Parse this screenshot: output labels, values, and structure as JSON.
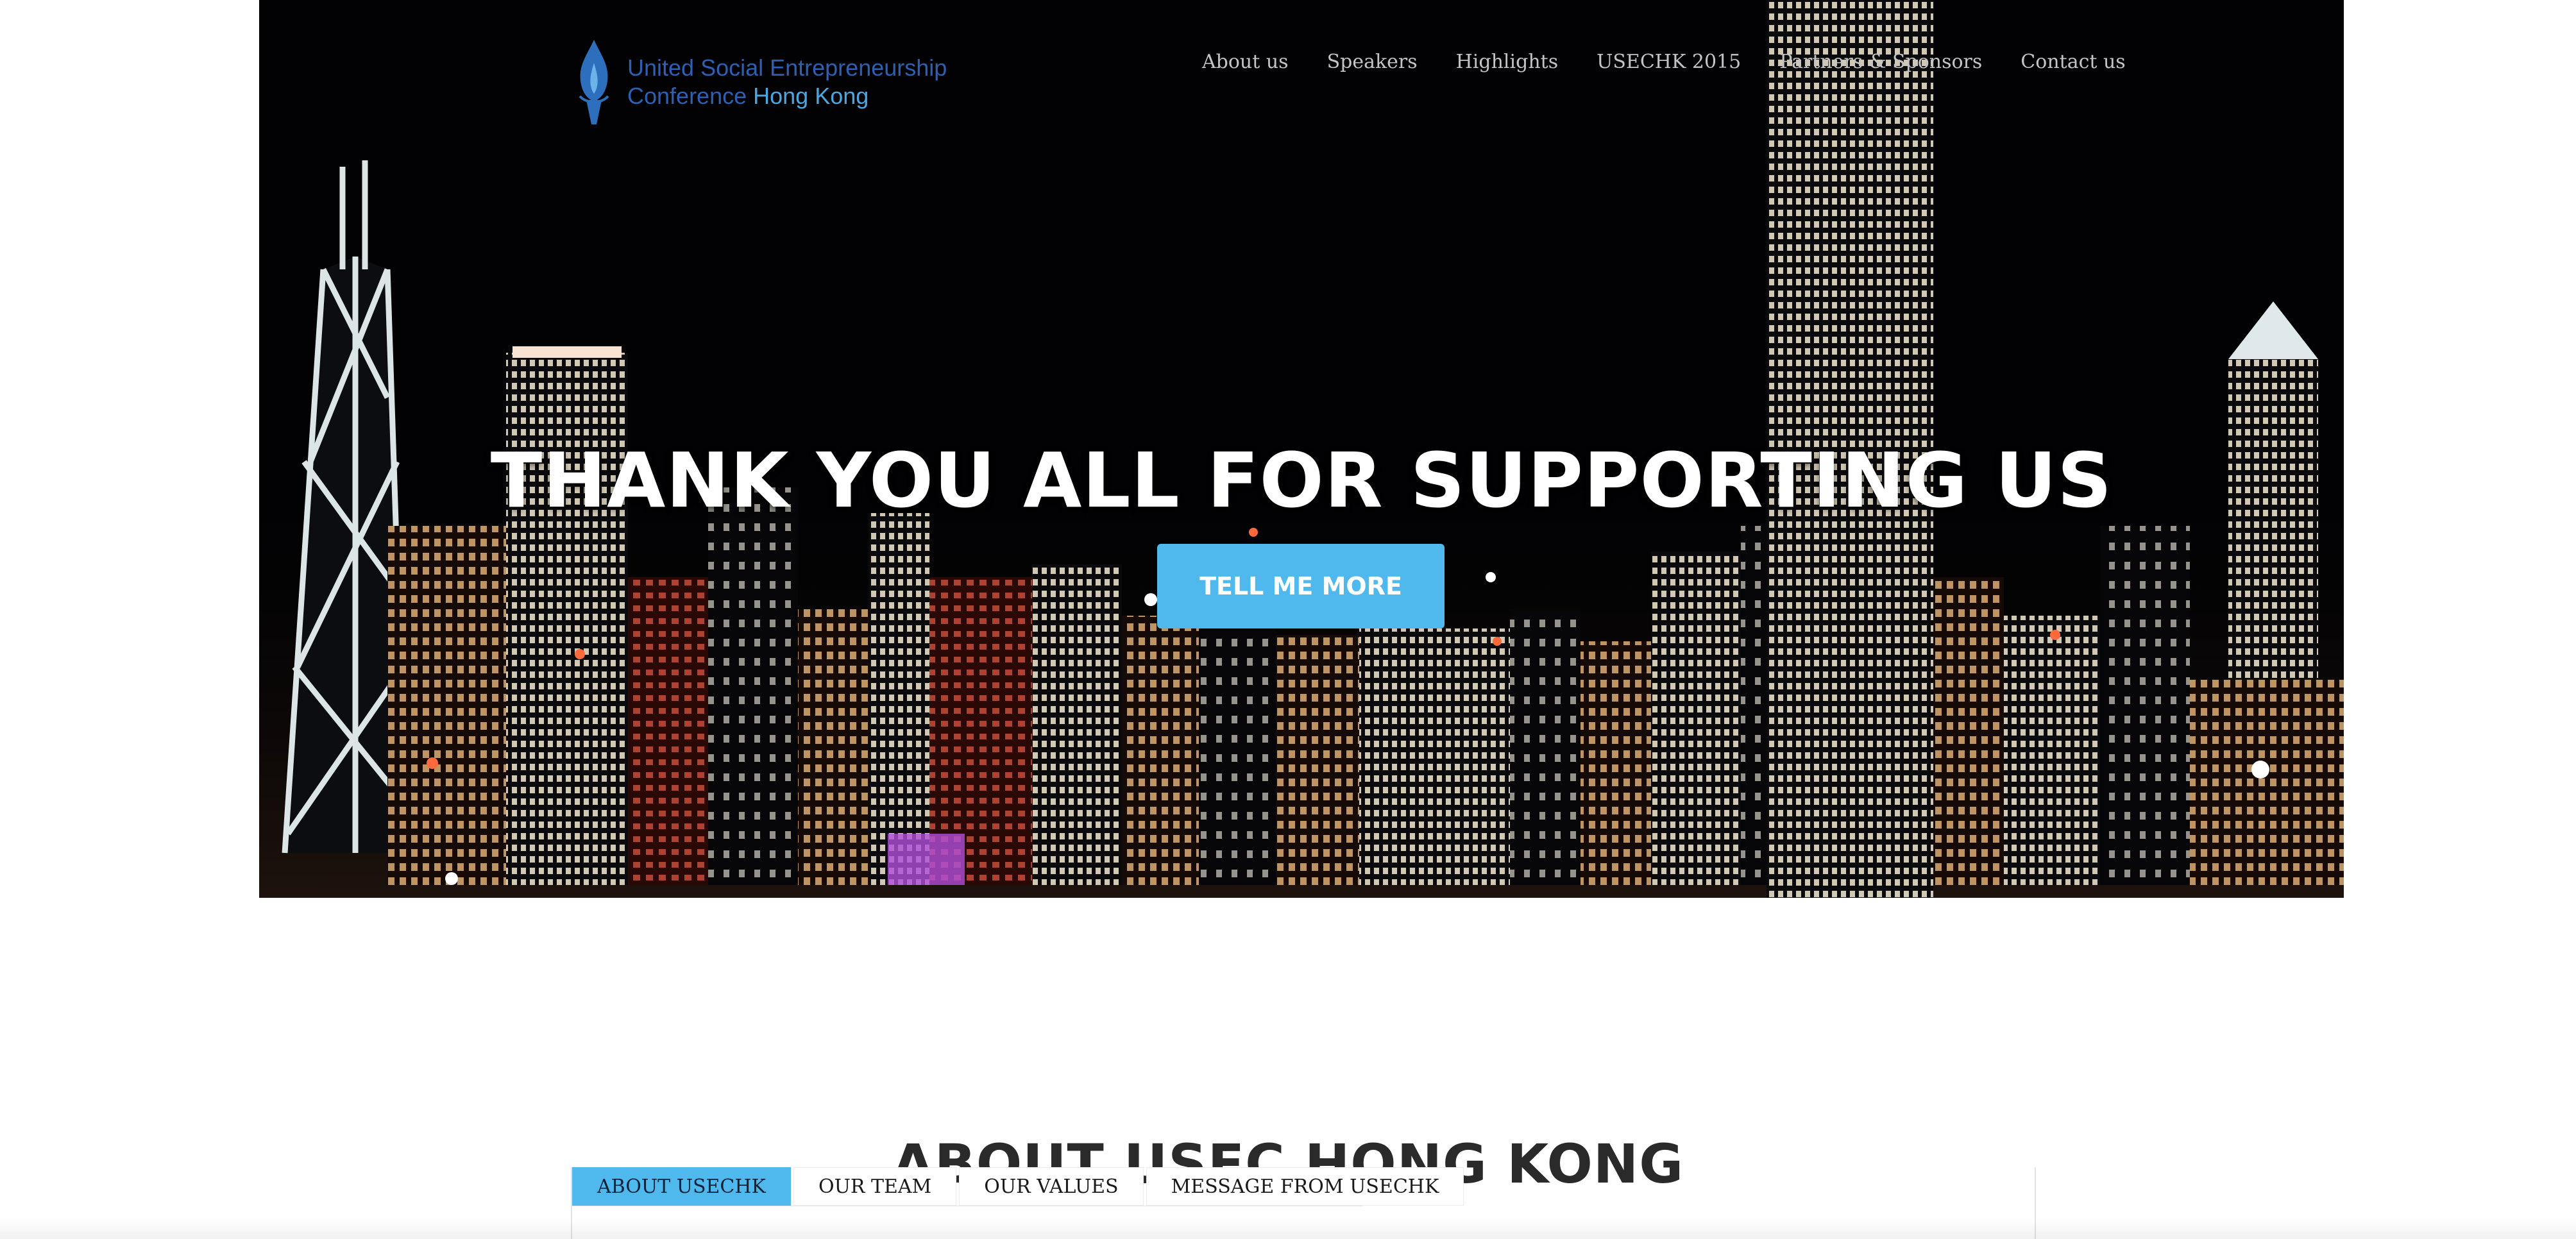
{
  "logo": {
    "line1": "United Social Entrepreneurship",
    "line2_prefix": "Conference ",
    "line2_accent": "Hong Kong",
    "icon": "torch-flame-icon"
  },
  "nav": {
    "items": [
      "About us",
      "Speakers",
      "Highlights",
      "USECHK 2015",
      "Partners & Sponsors",
      "Contact us"
    ]
  },
  "hero": {
    "headline": "THANK YOU ALL FOR SUPPORTING US",
    "cta_label": "TELL ME MORE",
    "background": "hong-kong-night-skyline"
  },
  "about": {
    "title": "ABOUT USEC HONG KONG",
    "tabs": [
      "ABOUT USECHK",
      "OUR TEAM",
      "OUR VALUES",
      "MESSAGE FROM USECHK"
    ],
    "active_tab": "ABOUT USECHK"
  },
  "colors": {
    "accent": "#4fb8ec",
    "logo_blue": "#2d5fb3",
    "logo_light_blue": "#4aa7e0",
    "hero_bg": "#020204",
    "heading_text": "#2a2a2a"
  }
}
